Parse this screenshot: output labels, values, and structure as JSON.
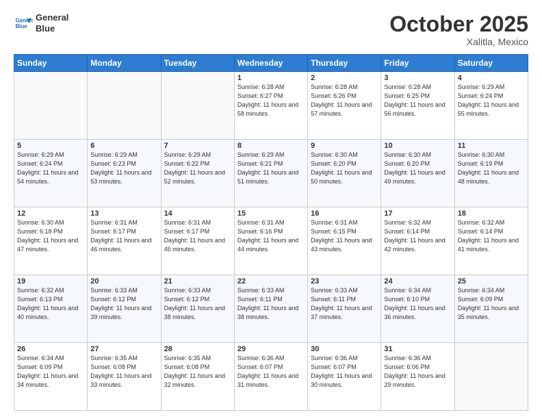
{
  "header": {
    "logo_line1": "General",
    "logo_line2": "Blue",
    "month": "October 2025",
    "location": "Xalitla, Mexico"
  },
  "weekdays": [
    "Sunday",
    "Monday",
    "Tuesday",
    "Wednesday",
    "Thursday",
    "Friday",
    "Saturday"
  ],
  "weeks": [
    [
      {
        "day": "",
        "detail": ""
      },
      {
        "day": "",
        "detail": ""
      },
      {
        "day": "",
        "detail": ""
      },
      {
        "day": "1",
        "detail": "Sunrise: 6:28 AM\nSunset: 6:27 PM\nDaylight: 11 hours\nand 58 minutes."
      },
      {
        "day": "2",
        "detail": "Sunrise: 6:28 AM\nSunset: 6:26 PM\nDaylight: 11 hours\nand 57 minutes."
      },
      {
        "day": "3",
        "detail": "Sunrise: 6:28 AM\nSunset: 6:25 PM\nDaylight: 11 hours\nand 56 minutes."
      },
      {
        "day": "4",
        "detail": "Sunrise: 6:29 AM\nSunset: 6:24 PM\nDaylight: 11 hours\nand 55 minutes."
      }
    ],
    [
      {
        "day": "5",
        "detail": "Sunrise: 6:29 AM\nSunset: 6:24 PM\nDaylight: 11 hours\nand 54 minutes."
      },
      {
        "day": "6",
        "detail": "Sunrise: 6:29 AM\nSunset: 6:23 PM\nDaylight: 11 hours\nand 53 minutes."
      },
      {
        "day": "7",
        "detail": "Sunrise: 6:29 AM\nSunset: 6:22 PM\nDaylight: 11 hours\nand 52 minutes."
      },
      {
        "day": "8",
        "detail": "Sunrise: 6:29 AM\nSunset: 6:21 PM\nDaylight: 11 hours\nand 51 minutes."
      },
      {
        "day": "9",
        "detail": "Sunrise: 6:30 AM\nSunset: 6:20 PM\nDaylight: 11 hours\nand 50 minutes."
      },
      {
        "day": "10",
        "detail": "Sunrise: 6:30 AM\nSunset: 6:20 PM\nDaylight: 11 hours\nand 49 minutes."
      },
      {
        "day": "11",
        "detail": "Sunrise: 6:30 AM\nSunset: 6:19 PM\nDaylight: 11 hours\nand 48 minutes."
      }
    ],
    [
      {
        "day": "12",
        "detail": "Sunrise: 6:30 AM\nSunset: 6:18 PM\nDaylight: 11 hours\nand 47 minutes."
      },
      {
        "day": "13",
        "detail": "Sunrise: 6:31 AM\nSunset: 6:17 PM\nDaylight: 11 hours\nand 46 minutes."
      },
      {
        "day": "14",
        "detail": "Sunrise: 6:31 AM\nSunset: 6:17 PM\nDaylight: 11 hours\nand 45 minutes."
      },
      {
        "day": "15",
        "detail": "Sunrise: 6:31 AM\nSunset: 6:16 PM\nDaylight: 11 hours\nand 44 minutes."
      },
      {
        "day": "16",
        "detail": "Sunrise: 6:31 AM\nSunset: 6:15 PM\nDaylight: 11 hours\nand 43 minutes."
      },
      {
        "day": "17",
        "detail": "Sunrise: 6:32 AM\nSunset: 6:14 PM\nDaylight: 11 hours\nand 42 minutes."
      },
      {
        "day": "18",
        "detail": "Sunrise: 6:32 AM\nSunset: 6:14 PM\nDaylight: 11 hours\nand 41 minutes."
      }
    ],
    [
      {
        "day": "19",
        "detail": "Sunrise: 6:32 AM\nSunset: 6:13 PM\nDaylight: 11 hours\nand 40 minutes."
      },
      {
        "day": "20",
        "detail": "Sunrise: 6:33 AM\nSunset: 6:12 PM\nDaylight: 11 hours\nand 39 minutes."
      },
      {
        "day": "21",
        "detail": "Sunrise: 6:33 AM\nSunset: 6:12 PM\nDaylight: 11 hours\nand 38 minutes."
      },
      {
        "day": "22",
        "detail": "Sunrise: 6:33 AM\nSunset: 6:11 PM\nDaylight: 11 hours\nand 38 minutes."
      },
      {
        "day": "23",
        "detail": "Sunrise: 6:33 AM\nSunset: 6:11 PM\nDaylight: 11 hours\nand 37 minutes."
      },
      {
        "day": "24",
        "detail": "Sunrise: 6:34 AM\nSunset: 6:10 PM\nDaylight: 11 hours\nand 36 minutes."
      },
      {
        "day": "25",
        "detail": "Sunrise: 6:34 AM\nSunset: 6:09 PM\nDaylight: 11 hours\nand 35 minutes."
      }
    ],
    [
      {
        "day": "26",
        "detail": "Sunrise: 6:34 AM\nSunset: 6:09 PM\nDaylight: 11 hours\nand 34 minutes."
      },
      {
        "day": "27",
        "detail": "Sunrise: 6:35 AM\nSunset: 6:08 PM\nDaylight: 11 hours\nand 33 minutes."
      },
      {
        "day": "28",
        "detail": "Sunrise: 6:35 AM\nSunset: 6:08 PM\nDaylight: 11 hours\nand 32 minutes."
      },
      {
        "day": "29",
        "detail": "Sunrise: 6:36 AM\nSunset: 6:07 PM\nDaylight: 11 hours\nand 31 minutes."
      },
      {
        "day": "30",
        "detail": "Sunrise: 6:36 AM\nSunset: 6:07 PM\nDaylight: 11 hours\nand 30 minutes."
      },
      {
        "day": "31",
        "detail": "Sunrise: 6:36 AM\nSunset: 6:06 PM\nDaylight: 11 hours\nand 29 minutes."
      },
      {
        "day": "",
        "detail": ""
      }
    ]
  ]
}
